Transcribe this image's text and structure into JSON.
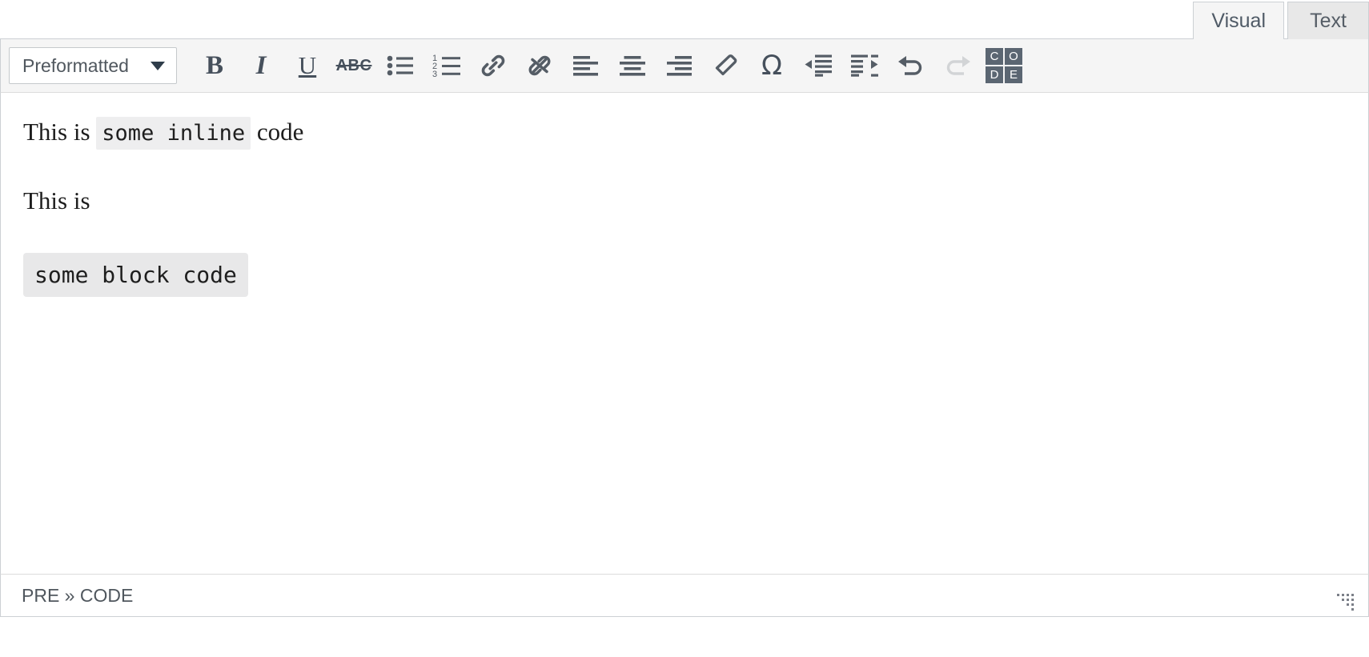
{
  "editor": {
    "tabs": [
      {
        "label": "Visual",
        "name": "tab-visual",
        "active": true
      },
      {
        "label": "Text",
        "name": "tab-text",
        "active": false
      }
    ],
    "toolbar": {
      "format_select": {
        "value": "Preformatted",
        "caret_icon": "chevron-down-icon"
      },
      "buttons": [
        {
          "name": "bold-button",
          "label": "B",
          "icon": "bold-icon",
          "disabled": false
        },
        {
          "name": "italic-button",
          "label": "I",
          "icon": "italic-icon",
          "disabled": false
        },
        {
          "name": "underline-button",
          "label": "U",
          "icon": "underline-icon",
          "disabled": false
        },
        {
          "name": "strikethrough-button",
          "label": "ABC",
          "icon": "strikethrough-icon",
          "disabled": false
        },
        {
          "name": "bulleted-list-button",
          "label": "",
          "icon": "bulleted-list-icon",
          "disabled": false
        },
        {
          "name": "numbered-list-button",
          "label": "",
          "icon": "numbered-list-icon",
          "disabled": false
        },
        {
          "name": "insert-link-button",
          "label": "",
          "icon": "link-icon",
          "disabled": false
        },
        {
          "name": "remove-link-button",
          "label": "",
          "icon": "unlink-icon",
          "disabled": false
        },
        {
          "name": "align-left-button",
          "label": "",
          "icon": "align-left-icon",
          "disabled": false
        },
        {
          "name": "align-center-button",
          "label": "",
          "icon": "align-center-icon",
          "disabled": false
        },
        {
          "name": "align-right-button",
          "label": "",
          "icon": "align-right-icon",
          "disabled": false
        },
        {
          "name": "clear-formatting-button",
          "label": "",
          "icon": "eraser-icon",
          "disabled": false
        },
        {
          "name": "special-character-button",
          "label": "Ω",
          "icon": "omega-icon",
          "disabled": false
        },
        {
          "name": "outdent-button",
          "label": "",
          "icon": "outdent-icon",
          "disabled": false
        },
        {
          "name": "indent-button",
          "label": "",
          "icon": "indent-icon",
          "disabled": false
        },
        {
          "name": "undo-button",
          "label": "",
          "icon": "undo-icon",
          "disabled": false
        },
        {
          "name": "redo-button",
          "label": "",
          "icon": "redo-icon",
          "disabled": true
        },
        {
          "name": "code-block-button",
          "label": "CODE",
          "icon": "code-block-icon",
          "disabled": false
        }
      ],
      "code_icon_letters": [
        "C",
        "O",
        "D",
        "E"
      ]
    },
    "content": {
      "paragraph_1": {
        "prefix": "This is ",
        "code": "some inline",
        "suffix": " code"
      },
      "paragraph_2": {
        "text": "This is"
      },
      "code_block": {
        "text": "some block code"
      }
    },
    "statusbar": {
      "path": "PRE » CODE",
      "resize_handle_icon": "resize-grip-icon"
    },
    "colors": {
      "toolbar_bg": "#f5f5f5",
      "border": "#ccd0d4",
      "icon": "#555d66",
      "code_bg": "#e8e8e9",
      "inline_code_bg": "#eeeeef",
      "text": "#1e1e1e",
      "muted_text": "#50575e"
    }
  }
}
